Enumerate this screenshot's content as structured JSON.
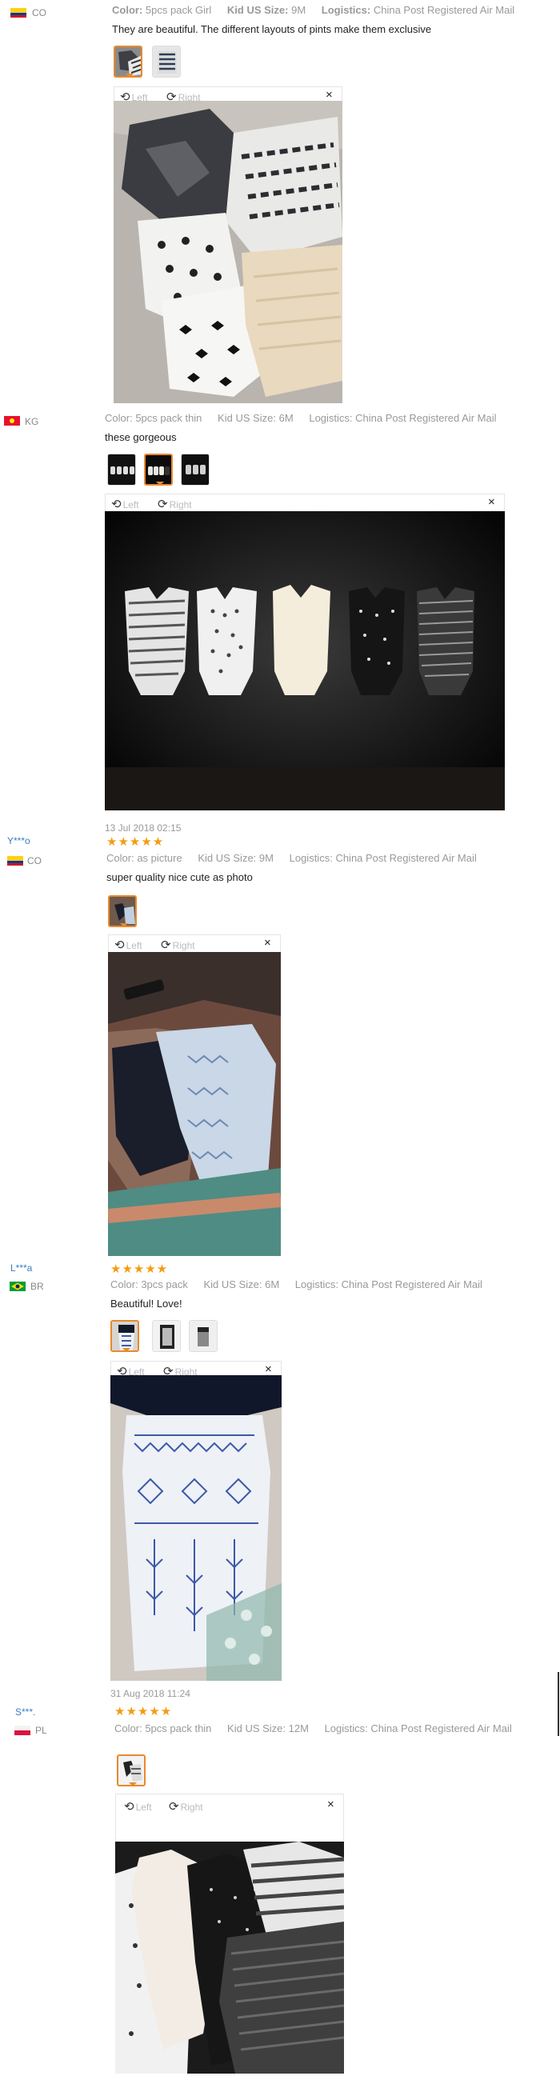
{
  "labels": {
    "color": "Color:",
    "size": "Kid US Size:",
    "logistics": "Logistics:",
    "left": "Left",
    "right": "Right",
    "close": "×"
  },
  "reviews": [
    {
      "user": "",
      "country": "CO",
      "date": "",
      "stars": 0,
      "color": "5pcs pack Girl",
      "size": "9M",
      "logistics": "China Post Registered Air Mail",
      "comment": "They are beautiful. The different layouts of pints make them exclusive"
    },
    {
      "user": "",
      "country": "KG",
      "date": "",
      "stars": 0,
      "color": "5pcs pack thin",
      "size": "6M",
      "logistics": "China Post Registered Air Mail",
      "comment": "these gorgeous"
    },
    {
      "user": "Y***o",
      "country": "CO",
      "date": "13 Jul 2018 02:15",
      "stars": 5,
      "color": "as picture",
      "size": "9M",
      "logistics": "China Post Registered Air Mail",
      "comment": "super quality nice cute as photo"
    },
    {
      "user": "L***a",
      "country": "BR",
      "date": "",
      "stars": 5,
      "color": "3pcs pack",
      "size": "6M",
      "logistics": "China Post Registered Air Mail",
      "comment": "Beautiful! Love!"
    },
    {
      "user": "S***.",
      "country": "PL",
      "date": "31 Aug 2018 11:24",
      "stars": 5,
      "color": "5pcs pack thin",
      "size": "12M",
      "logistics": "China Post Registered Air Mail",
      "comment": ""
    }
  ],
  "stars_text": "★★★★★",
  "colors": {
    "star": "#f39c12",
    "username": "#3b7fc4",
    "active_thumb": "#e8892d"
  }
}
